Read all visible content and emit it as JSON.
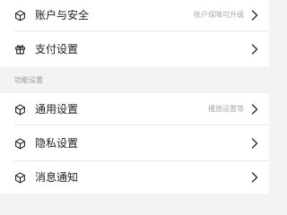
{
  "settings": {
    "top_group": [
      {
        "label": "账户与安全",
        "hint": "账户保障可升级",
        "icon": "cube-icon"
      },
      {
        "label": "支付设置",
        "hint": "",
        "icon": "gift-icon"
      }
    ],
    "feature_section_title": "功能设置",
    "feature_group": [
      {
        "label": "通用设置",
        "hint": "播放设置等",
        "icon": "cube-icon"
      },
      {
        "label": "隐私设置",
        "hint": "",
        "icon": "cube-icon"
      },
      {
        "label": "消息通知",
        "hint": "",
        "icon": "cube-icon"
      }
    ]
  },
  "colors": {
    "background": "#f3f3f3",
    "card": "#ffffff",
    "text": "#1f1f1f",
    "hint": "#a8a8a8",
    "section_title": "#9a9a9a"
  }
}
